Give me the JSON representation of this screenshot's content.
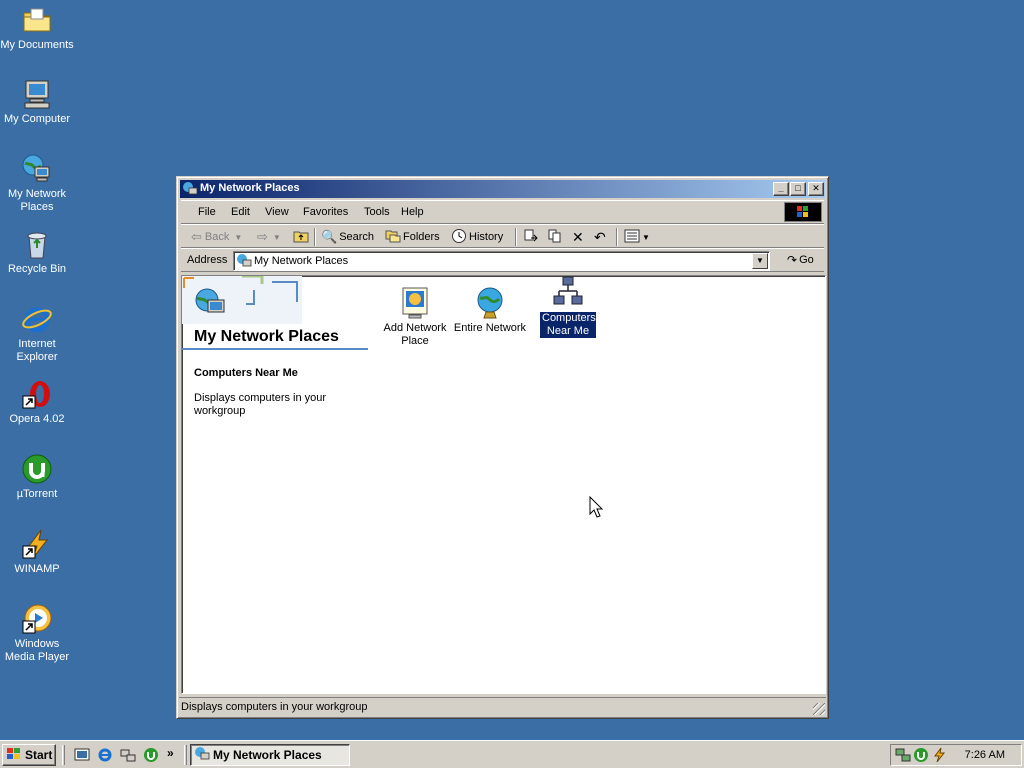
{
  "desktop": {
    "icons": [
      {
        "label": "My Documents"
      },
      {
        "label": "My Computer"
      },
      {
        "label": "My Network Places"
      },
      {
        "label": "Recycle Bin"
      },
      {
        "label": "Internet Explorer"
      },
      {
        "label": "Opera 4.02"
      },
      {
        "label": "µTorrent"
      },
      {
        "label": "WINAMP"
      },
      {
        "label": "Windows Media Player"
      }
    ],
    "background_color": "#3a6ea5"
  },
  "window": {
    "title": "My Network Places",
    "menu": [
      "File",
      "Edit",
      "View",
      "Favorites",
      "Tools",
      "Help"
    ],
    "toolbar": {
      "back": "Back",
      "search": "Search",
      "folders": "Folders",
      "history": "History"
    },
    "address": {
      "label": "Address",
      "value": "My Network Places",
      "go": "Go"
    },
    "left_panel": {
      "title": "My Network Places",
      "selected_heading": "Computers Near Me",
      "selected_description": "Displays computers in your workgroup"
    },
    "items": [
      {
        "label": "Add Network Place",
        "icon": "add-network-place-icon",
        "selected": false
      },
      {
        "label": "Entire Network",
        "icon": "globe-icon",
        "selected": false
      },
      {
        "label": "Computers Near Me",
        "icon": "network-computers-icon",
        "selected": true
      }
    ],
    "status": "Displays computers in your workgroup"
  },
  "taskbar": {
    "start": "Start",
    "task": "My Network Places",
    "more": "»",
    "clock": "7:26 AM"
  },
  "colors": {
    "title_active_start": "#0a246a",
    "title_active_end": "#a6caf0",
    "selection": "#0a246a"
  }
}
